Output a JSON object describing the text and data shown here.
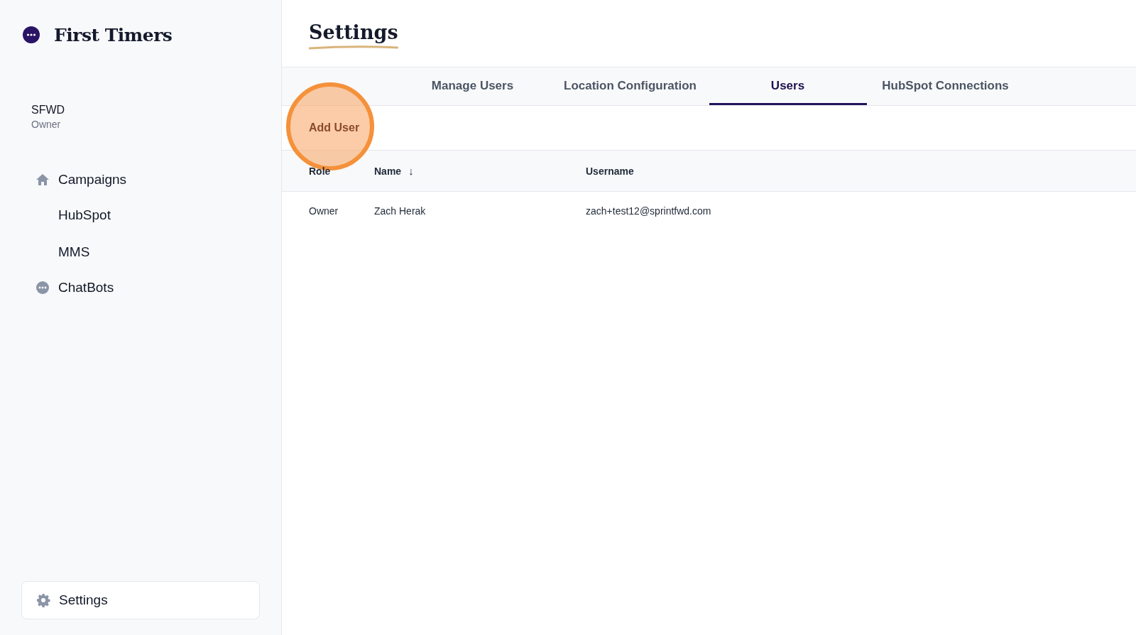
{
  "brand": {
    "name": "First Timers"
  },
  "account": {
    "name": "SFWD",
    "role": "Owner"
  },
  "sidebar": {
    "items": [
      {
        "label": "Campaigns",
        "children": [
          {
            "label": "HubSpot"
          },
          {
            "label": "MMS"
          }
        ]
      },
      {
        "label": "ChatBots"
      }
    ],
    "footer_item": {
      "label": "Settings"
    }
  },
  "page_title": "Settings",
  "tabs": [
    {
      "label": "Manage Users",
      "selected": false
    },
    {
      "label": "Location Configuration",
      "selected": false
    },
    {
      "label": "Users",
      "selected": true
    },
    {
      "label": "HubSpot Connections",
      "selected": false
    }
  ],
  "add_button": "Add User",
  "click_highlight": {
    "kind": "circle"
  },
  "table": {
    "columns": [
      {
        "label": "Role"
      },
      {
        "label": "Name",
        "sort_mark": "↓"
      },
      {
        "label": "Username"
      }
    ],
    "rows": [
      [
        "Owner",
        "Zach Herak",
        "zach+test12@sprintfwd.com"
      ]
    ]
  }
}
